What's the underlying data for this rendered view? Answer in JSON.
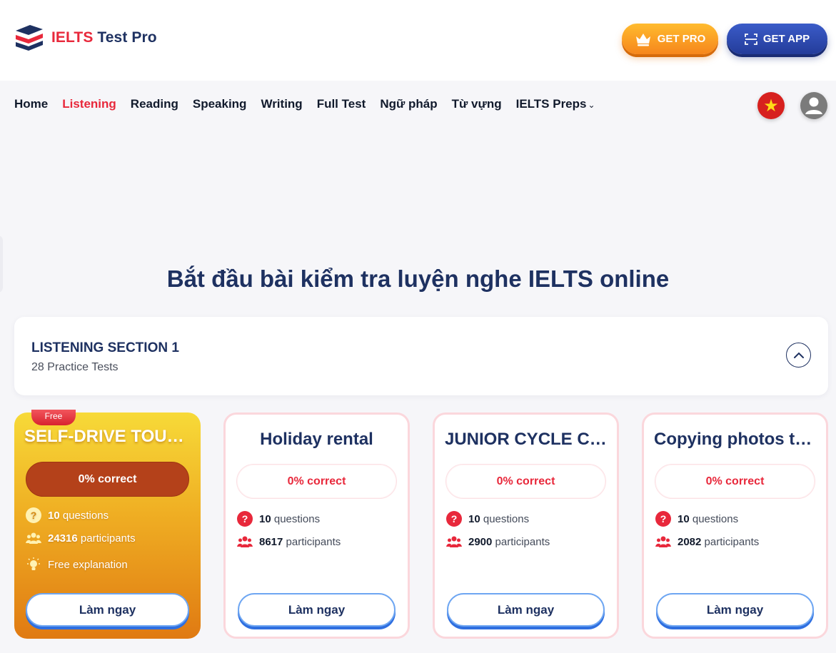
{
  "brand": {
    "name_a": "IELTS",
    "name_b": "Test Pro",
    "accent": "#e8283b",
    "navy": "#1e3161"
  },
  "header": {
    "get_pro": "GET PRO",
    "get_app": "GET APP"
  },
  "nav": [
    "Home",
    "Listening",
    "Reading",
    "Speaking",
    "Writing",
    "Full Test",
    "Ngữ pháp",
    "Từ vựng",
    "IELTS Preps"
  ],
  "nav_active": "Listening",
  "page_title": "Bắt đầu bài kiểm tra luyện nghe IELTS online",
  "section": {
    "title": "LISTENING SECTION 1",
    "subtitle": "28 Practice Tests"
  },
  "cards": [
    {
      "badge": "Free",
      "title": "SELF-DRIVE TOURS IN THE USA",
      "correct": "0% correct",
      "questions": "10",
      "questions_label": "questions",
      "participants": "24316",
      "participants_label": "participants",
      "extra": "Free explanation",
      "button": "Làm ngay"
    },
    {
      "title": "Holiday rental",
      "correct": "0% correct",
      "questions": "10",
      "questions_label": "questions",
      "participants": "8617",
      "participants_label": "participants",
      "button": "Làm ngay"
    },
    {
      "title": "JUNIOR CYCLE CAMP",
      "correct": "0% correct",
      "questions": "10",
      "questions_label": "questions",
      "participants": "2900",
      "participants_label": "participants",
      "button": "Làm ngay"
    },
    {
      "title": "Copying photos to digital format",
      "correct": "0% correct",
      "questions": "10",
      "questions_label": "questions",
      "participants": "2082",
      "participants_label": "participants",
      "button": "Làm ngay"
    }
  ]
}
